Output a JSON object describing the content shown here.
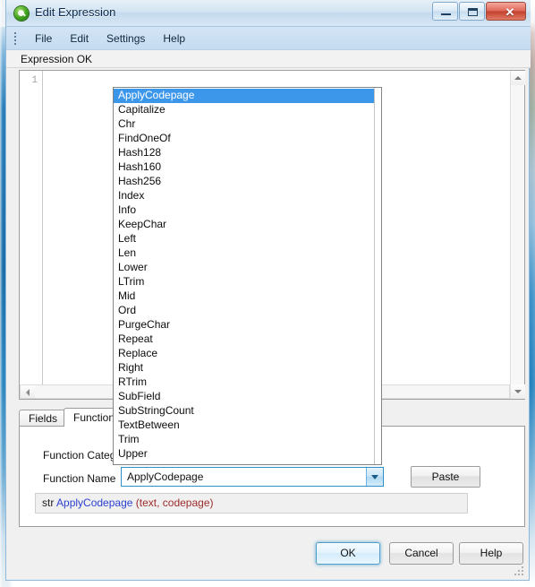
{
  "window": {
    "title": "Edit Expression",
    "icon": "expression-app-icon",
    "controls": {
      "minimize": "–",
      "maximize": "□",
      "close": "✕"
    }
  },
  "menubar": {
    "items": [
      {
        "label": "File"
      },
      {
        "label": "Edit"
      },
      {
        "label": "Settings"
      },
      {
        "label": "Help"
      }
    ]
  },
  "status": {
    "text": "Expression OK"
  },
  "editor": {
    "line_number": "1",
    "content": ""
  },
  "tabs": [
    {
      "label": "Fields",
      "active": false
    },
    {
      "label": "Functions",
      "active": true
    }
  ],
  "functions_panel": {
    "category_label": "Function Category",
    "name_label": "Function Name",
    "category_value": "",
    "name_value": "ApplyCodepage",
    "paste_label": "Paste",
    "signature": {
      "return_type": "str",
      "function": "ApplyCodepage",
      "arguments": "(text, codepage)",
      "return_type_color": "#202020",
      "function_color": "#2b3fd0",
      "arguments_color": "#9d2b2b"
    }
  },
  "dropdown": {
    "selected": "ApplyCodepage",
    "highlight_color": "#3c97eb",
    "items": [
      "ApplyCodepage",
      "Capitalize",
      "Chr",
      "FindOneOf",
      "Hash128",
      "Hash160",
      "Hash256",
      "Index",
      "Info",
      "KeepChar",
      "Left",
      "Len",
      "Lower",
      "LTrim",
      "Mid",
      "Ord",
      "PurgeChar",
      "Repeat",
      "Replace",
      "Right",
      "RTrim",
      "SubField",
      "SubStringCount",
      "TextBetween",
      "Trim",
      "Upper"
    ]
  },
  "buttons": {
    "ok": "OK",
    "cancel": "Cancel",
    "help": "Help"
  }
}
